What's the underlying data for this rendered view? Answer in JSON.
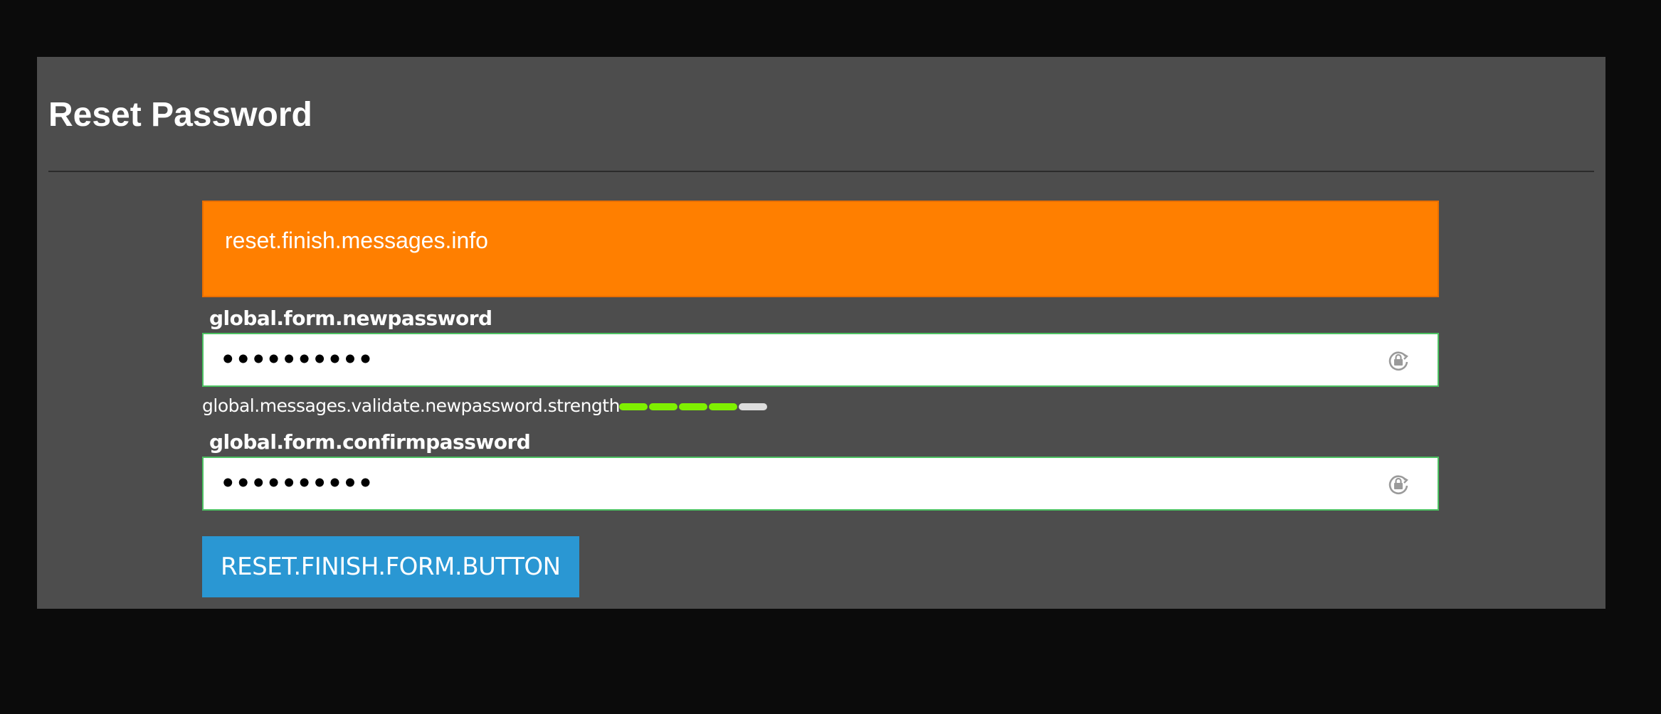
{
  "page": {
    "title": "Reset Password"
  },
  "alert": {
    "text": "reset.finish.messages.info",
    "color": "#ff7f00"
  },
  "form": {
    "new_password": {
      "label": "global.form.newpassword",
      "value": "••••••••••",
      "icon": "lock-refresh-icon"
    },
    "strength": {
      "text": "global.messages.validate.newpassword.strength",
      "level": 4,
      "max": 5,
      "on_color": "#7ff000",
      "off_color": "#dddddd"
    },
    "confirm_password": {
      "label": "global.form.confirmpassword",
      "value": "••••••••••",
      "icon": "lock-refresh-icon"
    },
    "submit": {
      "label": "RESET.FINISH.FORM.BUTTON",
      "color": "#2a97d3"
    }
  }
}
